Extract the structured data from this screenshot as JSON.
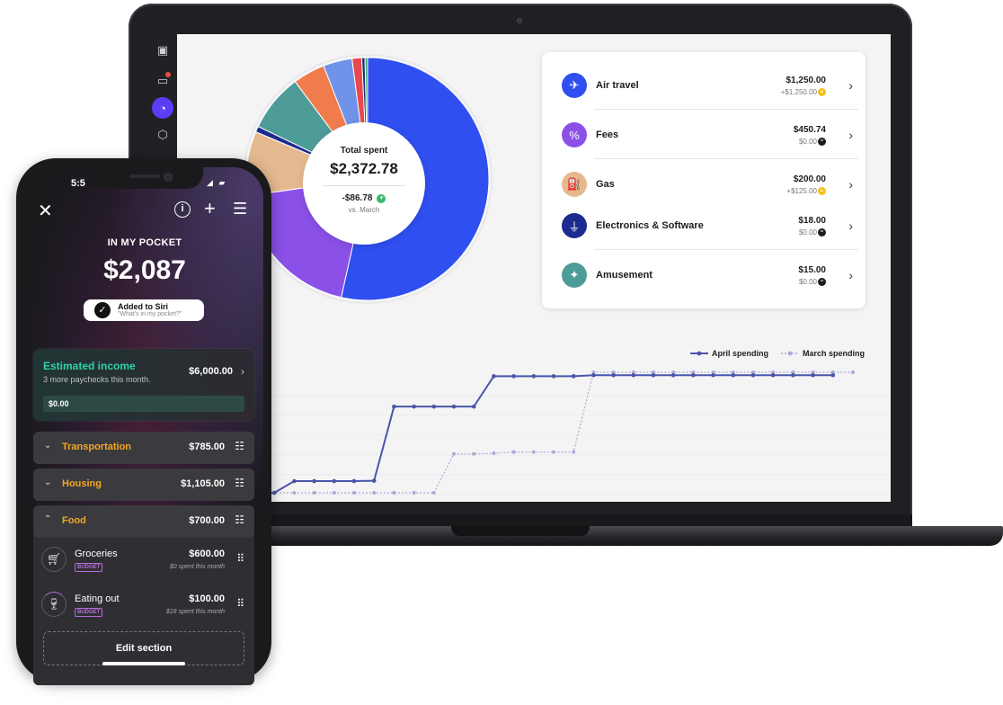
{
  "laptop": {
    "sidebar": {
      "items": [
        "logo-icon",
        "wallet-icon",
        "pie-chart-icon",
        "box-icon",
        "more-icon"
      ]
    },
    "summary": {
      "label": "Total spent",
      "value": "$2,372.78",
      "delta": "-$86.78",
      "comparison": "vs. March"
    },
    "chart_data": [
      {
        "type": "pie",
        "style": "donut",
        "title": "",
        "categories": [
          "Air travel",
          "Fees",
          "Gas",
          "Electronics & Software",
          "Other (teal)",
          "Other (orange)",
          "Other (blue)",
          "Other (red)",
          "Other (navy)",
          "Other (green)"
        ],
        "values": [
          1250.0,
          450.74,
          200.0,
          18.0,
          180.0,
          100.0,
          90.0,
          30.0,
          10.0,
          8.0
        ],
        "colors": [
          "#2f4ff0",
          "#8b50e8",
          "#e4b98f",
          "#1b2b8f",
          "#4e9c98",
          "#f07c4e",
          "#6e93e8",
          "#e8494d",
          "#1c2b7a",
          "#3aa66a"
        ]
      },
      {
        "type": "line",
        "title": "",
        "series": [
          {
            "name": "April spending",
            "color": "#4b55a8",
            "values": [
              0,
              0,
              180,
              180,
              180,
              180,
              185,
              1330,
              1330,
              1330,
              1330,
              1330,
              1800,
              1800,
              1800,
              1800,
              1800,
              1815,
              1815,
              1815,
              1815,
              1815,
              1815,
              1815,
              1815,
              1815,
              1815,
              1815,
              1815,
              1815
            ]
          },
          {
            "name": "March spending",
            "color": "#a9abd6",
            "values": [
              0,
              0,
              0,
              0,
              0,
              0,
              0,
              0,
              0,
              0,
              600,
              600,
              610,
              630,
              630,
              630,
              630,
              1860,
              1860,
              1860,
              1860,
              1860,
              1860,
              1860,
              1860,
              1860,
              1860,
              1860,
              1860,
              1860,
              1860
            ]
          }
        ],
        "legend": "top-right"
      }
    ],
    "categories": [
      {
        "name": "Air travel",
        "amount": "$1,250.00",
        "sub": "+$1,250.00",
        "icon": "airplane-icon",
        "icon_color": "#2f4ff0",
        "badge_color": "#f5c21b"
      },
      {
        "name": "Fees",
        "amount": "$450.74",
        "sub": "$0.00",
        "icon": "percent-icon",
        "icon_color": "#8b50e8",
        "badge_color": "#1c1c1e"
      },
      {
        "name": "Gas",
        "amount": "$200.00",
        "sub": "+$125.00",
        "icon": "fuel-icon",
        "icon_color": "#e4b98f",
        "badge_color": "#f5c21b"
      },
      {
        "name": "Electronics & Software",
        "amount": "$18.00",
        "sub": "$0.00",
        "icon": "plug-icon",
        "icon_color": "#1b2b8f",
        "badge_color": "#1c1c1e"
      },
      {
        "name": "Amusement",
        "amount": "$15.00",
        "sub": "$0.00",
        "icon": "ticket-icon",
        "icon_color": "#4e9c98",
        "badge_color": "#1c1c1e"
      }
    ]
  },
  "phone": {
    "status_time": "5:5",
    "pocket_label": "IN MY POCKET",
    "pocket_value": "$2,087",
    "siri": {
      "title": "Added to Siri",
      "subtitle": "\"What's in my pocket?\""
    },
    "income": {
      "title": "Estimated income",
      "subtitle": "3 more paychecks this month.",
      "amount": "$6,000.00",
      "progress_label": "$0.00"
    },
    "sections": [
      {
        "name": "Transportation",
        "amount": "$785.00"
      },
      {
        "name": "Housing",
        "amount": "$1,105.00"
      },
      {
        "name": "Food",
        "amount": "$700.00"
      }
    ],
    "food_items": [
      {
        "name": "Groceries",
        "tag": "BUDGET",
        "amount": "$600.00",
        "sub": "$0 spent this month",
        "icon": "cart-icon"
      },
      {
        "name": "Eating out",
        "tag": "BUDGET",
        "amount": "$100.00",
        "sub": "$18 spent this month",
        "icon": "dining-icon"
      }
    ],
    "edit_label": "Edit section"
  }
}
